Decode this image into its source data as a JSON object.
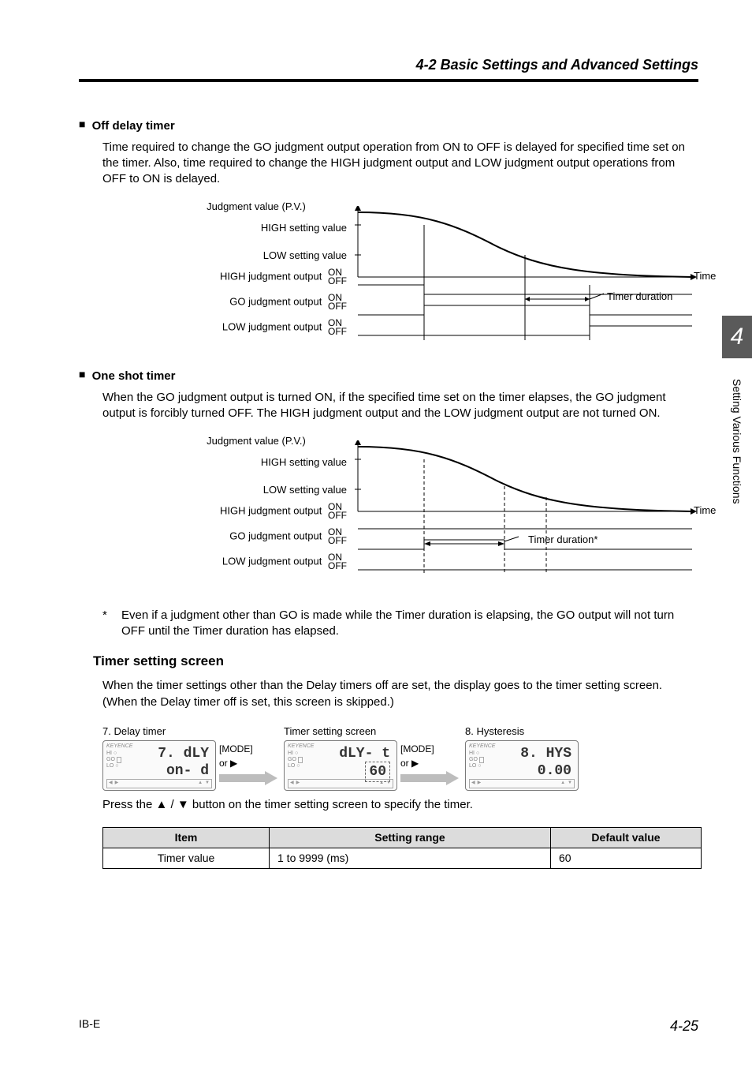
{
  "header": {
    "title": "4-2  Basic Settings and Advanced Settings"
  },
  "side_tab": {
    "number": "4",
    "label": "Setting Various Functions"
  },
  "off_delay": {
    "heading": "Off delay timer",
    "text": "Time required to change the GO judgment output operation from ON to OFF is delayed for specified time set on the timer. Also, time required to change the HIGH judgment output and LOW judgment output operations from OFF to ON is delayed.",
    "labels": {
      "pv": "Judgment value (P.V.)",
      "high_set": "HIGH setting value",
      "low_set": "LOW setting value",
      "high_out": "HIGH judgment output",
      "go_out": "GO judgment output",
      "low_out": "LOW judgment output",
      "on": "ON",
      "off": "OFF",
      "time": "Time",
      "timer_dur": "Timer duration"
    }
  },
  "one_shot": {
    "heading": "One shot timer",
    "text": "When the GO judgment output is turned ON, if the specified time set on the timer elapses, the GO judgment output is forcibly turned OFF. The HIGH judgment output and the LOW judgment output are not turned ON.",
    "labels": {
      "pv": "Judgment value (P.V.)",
      "high_set": "HIGH setting value",
      "low_set": "LOW setting value",
      "high_out": "HIGH judgment output",
      "go_out": "GO judgment output",
      "low_out": "LOW judgment output",
      "on": "ON",
      "off": "OFF",
      "time": "Time",
      "timer_dur": "Timer duration*"
    },
    "footnote_mark": "*",
    "footnote": "Even if a judgment other than GO is made while the Timer duration is elapsing, the GO output will not turn OFF until the Timer duration has elapsed."
  },
  "timer_screen": {
    "heading": "Timer setting screen",
    "text": "When the timer settings other than the Delay timers off are set, the display goes to the timer setting screen. (When the Delay timer off is set, this screen is skipped.)",
    "step7_title": "7. Delay timer",
    "mid_title": "Timer setting screen",
    "step8_title": "8. Hysteresis",
    "mode": "[MODE]",
    "or": "or ▶",
    "press_text": "Press the ▲ / ▼ button on the timer setting screen to specify the timer.",
    "panel_brand": "KEYENCE",
    "panel1": {
      "line1": "7.  dLY",
      "line2": "on- d"
    },
    "panel2": {
      "line1": "dLY- t",
      "line2": "60"
    },
    "panel3": {
      "line1": "8.  HYS",
      "line2": "0.00"
    }
  },
  "table": {
    "h_item": "Item",
    "h_range": "Setting range",
    "h_default": "Default value",
    "row": {
      "item": "Timer value",
      "range": "1 to 9999 (ms)",
      "default": "60"
    }
  },
  "footer": {
    "model": "IB-E",
    "page": "4-25"
  }
}
